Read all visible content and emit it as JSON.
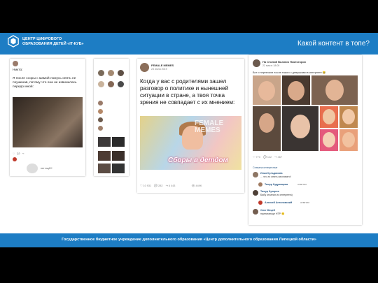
{
  "header": {
    "org_name": "ЦЕНТР ЦИФРОВОГО ОБРАЗОВАНИЯ ДЕТЕЙ «IT-КУБ»",
    "slide_title": "Какой контент в топе?"
  },
  "footer": {
    "text": "Государственное бюджетное учреждение дополнительного образования «Центр дополнительного образования Липецкой области»"
  },
  "colors": {
    "brand_blue": "#1d7dc4",
    "background": "#000000",
    "content_bg": "#ffffff"
  },
  "post1": {
    "text": "Никто:\n\nЯ после ссоры с мамой ложусь опять не поужинав, потому что она не извинилась передо мной:",
    "reply_text": "нет ещё!!!"
  },
  "post2": {
    "author": "FEMALE MEMES",
    "date": "23 июля 2019",
    "text": "Когда у вас с родителями зашел разговор о политике и нынешней ситуации в стране, а твоя точка зрения не совпадает с их мнением:",
    "watermark": "FEMALE MEMES",
    "image_caption": "Сборы в детдом",
    "likes": "10 931",
    "comments": "282",
    "reposts": "6 443",
    "views": "449K"
  },
  "post3": {
    "author": "На Стилий Вьюнич Никтогорих",
    "date": "22 мая в 18:00",
    "text": "Вот и переехали после такого с девушками в интернете 😂",
    "likes": "770",
    "comments": "122",
    "reposts": "467",
    "comments_label": "Сначала интересные",
    "comment_items": [
      {
        "author": "Илья Кульдасова",
        "text": "... что-то опять кисловато!"
      },
      {
        "author": "Тимур Кудрявцева",
        "text": "ответил"
      },
      {
        "author": "Тимур Кухарев",
        "text": "Бабу откатал из интернета)"
      },
      {
        "author": "Алексей Антоновский",
        "text": "ответил"
      },
      {
        "author": "Олег Мецей",
        "text": "прилагающе НТР 🙂"
      }
    ]
  }
}
